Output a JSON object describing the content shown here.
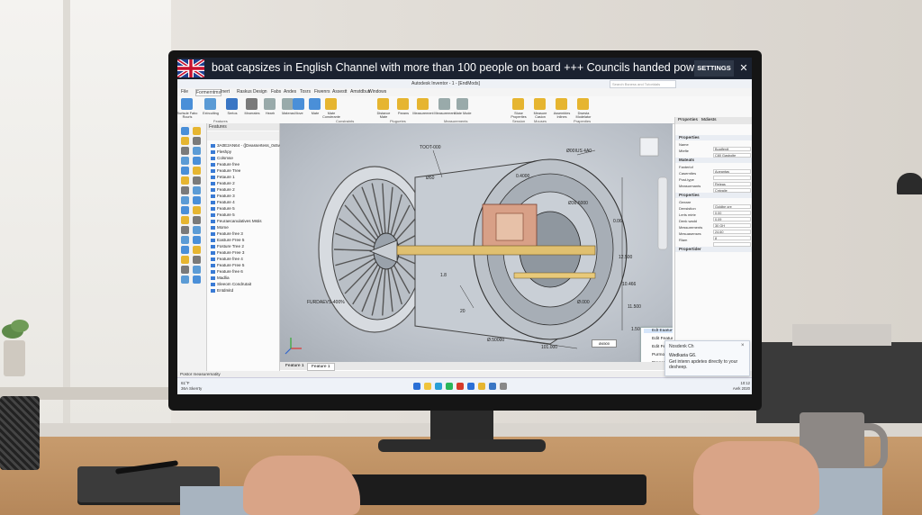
{
  "ticker": {
    "headline": "boat capsizes in English Channel with more than 100 people on board +++ Councils handed power to seize YOUR home",
    "settings_label": "SETTINGS",
    "close_label": "✕"
  },
  "app": {
    "title": "Autodesk Inventor - 1 - [EndMods]",
    "search_placeholder": "Search Bsness and Tutoridals",
    "menu": [
      "File",
      "Formerntms",
      "Inert",
      "Raskus",
      "Design",
      "Fabs",
      "Andes",
      "Tosrs",
      "Fiwenrs",
      "Assestt",
      "Amstdbus",
      "Windows"
    ]
  },
  "ribbon": {
    "buttons": [
      {
        "label": "Surtsde Fabo Rcurls",
        "color": "#4a8fd8"
      },
      {
        "label": "Extrculting",
        "color": "#5b9bd5"
      },
      {
        "label": "Sertos",
        "color": "#3a76c4"
      },
      {
        "label": "Mroerates",
        "color": "#7a7a7a"
      },
      {
        "label": "Hearh",
        "color": "#9aa"
      },
      {
        "label": "Materas",
        "color": "#9aa"
      },
      {
        "label": "Move",
        "color": "#4a8fd8"
      },
      {
        "label": "Mate",
        "color": "#4a8fd8"
      },
      {
        "label": "Mate Constrrante",
        "color": "#e6b530"
      },
      {
        "label": "Distance Mate",
        "color": "#e6b530"
      },
      {
        "label": "Parans",
        "color": "#e6b530"
      },
      {
        "label": "Measurement",
        "color": "#e6b530"
      },
      {
        "label": "Measurement",
        "color": "#9aa"
      },
      {
        "label": "Mate Mode",
        "color": "#9aa"
      },
      {
        "label": "Stuse Properties",
        "color": "#e6b530"
      },
      {
        "label": "Measure Casion",
        "color": "#e6b530"
      },
      {
        "label": "Assembles Inlines",
        "color": "#e6b530"
      },
      {
        "label": "Dwesta Modelator",
        "color": "#e6b530"
      }
    ],
    "groups": [
      "Features",
      "Constraints",
      "Pluguetes",
      "Measurements",
      "Session",
      "Mouses",
      "Prapenties"
    ]
  },
  "features_panel": {
    "title": "Features",
    "items": [
      "3A0E2AN64 - ([Deassertess_0x5v0ast]",
      "Fleshpy",
      "Colsmse",
      "Feature free",
      "Feature Tree",
      "Fetaure 1",
      "Feature 2",
      "Feature 2",
      "Feature 3",
      "Feature 4",
      "Feature 5",
      "Feature 5",
      "Feuraecanulatives Mstis",
      "Mome",
      "Feature free 3",
      "Easture Free 5",
      "Fosture Tree 2",
      "Feature Free 3",
      "Feature free 4",
      "Feature Free 5",
      "Feature free 6",
      "Madlia",
      "Sleeom Condrutait",
      "Entdmitd"
    ]
  },
  "viewport": {
    "labels": [
      "TOOT-000",
      "Ø00IUS 4A0",
      "Ø50",
      "0.06",
      "12.500",
      "10.466",
      "11.500",
      "Ø.000",
      "101.000",
      "Ø.50000",
      "1.500",
      "FURDAEVS-400%",
      "0.4000",
      "Ø36.6000",
      "1.8",
      "20"
    ],
    "tooltip": "Ø4500"
  },
  "context_menu": {
    "items": [
      "Edt Eaature...",
      "Edit Feature...",
      "Edit Feature...",
      "Purmors",
      "Prapenties"
    ]
  },
  "properties_panel": {
    "tabs": [
      "Properties",
      "Mdiests"
    ],
    "sections": [
      {
        "title": "Properties",
        "rows": [
          [
            "Name",
            "Boatferdt"
          ],
          [
            "Mtefie",
            "C80 Gasbolte"
          ]
        ]
      },
      {
        "title": "Mateats",
        "rows": [
          [
            "Fanterlof",
            "Aoeantas"
          ],
          [
            "Caserntles",
            ""
          ],
          [
            "Post-type",
            "Releas"
          ],
          [
            "Measurmants",
            "Cntvalie"
          ]
        ]
      },
      {
        "title": "Properties",
        "rows": [
          [
            "Geeare",
            "Goldbe ore"
          ],
          [
            "Densistion",
            "0.00"
          ],
          [
            "Lerts mirte",
            "0.09"
          ],
          [
            "Denk wadd",
            "30 GH"
          ],
          [
            "Messurements",
            "24.60"
          ],
          [
            "Mesuasenses",
            "8"
          ],
          [
            "Rlam",
            ""
          ]
        ]
      },
      {
        "title": "Propertider",
        "rows": []
      }
    ]
  },
  "doc_tabs": [
    "Feature 1",
    "Feature 1"
  ],
  "status_text": "Postor measurematity",
  "taskbar": {
    "weather_temp": "61°F",
    "weather_desc": "36A Skerrty",
    "time": "10:12",
    "date": "Aerk 2020"
  },
  "toast": {
    "title": "Nosdenk Ch",
    "heading": "Wedkaria G6.",
    "body": "Get intenn apdetes directly to your desheep."
  },
  "colors": {
    "ticker_bg": "#1b2230",
    "selection": "#d6e6fa",
    "accent": "#e6b530"
  }
}
